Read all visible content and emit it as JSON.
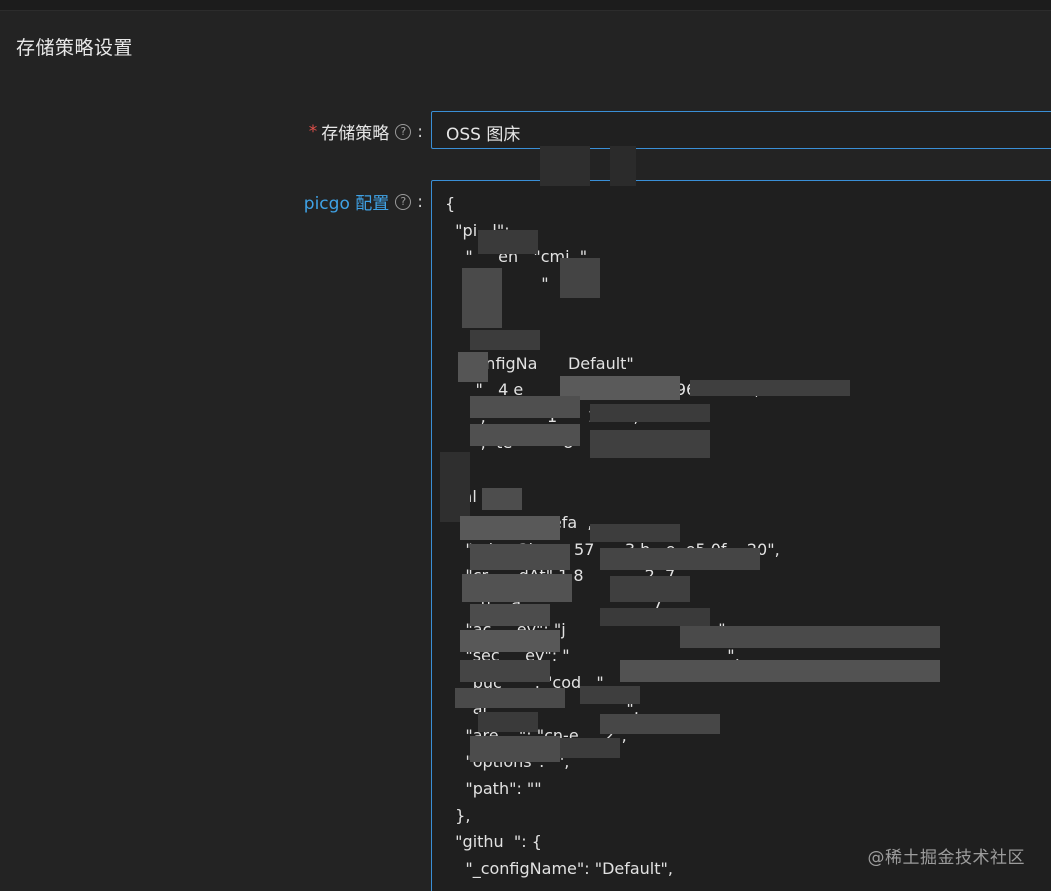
{
  "section": {
    "title": "存储策略设置"
  },
  "form": {
    "strategy_label": "存储策略",
    "required_mark": "*",
    "strategy_help": "?",
    "strategy_colon": ":",
    "strategy_value": "OSS 图床",
    "picgo_label": "picgo 配置",
    "picgo_help": "?",
    "picgo_colon": ":",
    "picgo_config_lines": [
      "{",
      "  \"pi   l\":",
      "    \"     en   \"cmi  \"",
      "         a        \"",
      "",
      "       e    \"\",",
      "      onfigNa      Default\"",
      "      \"   4 e        4        43 7 8696 29   2\",",
      "       ;            1      1     3,",
      "       ;  te          8        0      51",
      "  },",
      "  \"al  \" {",
      "    \"_    am     efa  ,",
      "    \"  d     3ba     57      3 b   e  e5 0f    20\",",
      "    \"cr      dAt\" 1 8            2  7",
      "    \"_u    a                          7",
      "    \"ac     ey\": \"j                              \",",
      "    \"sec     ey\": \"                               \",",
      "    \"buc     \": \"cod   \",",
      "    \"ar                           \",",
      "    \"are    \": \"cn-e     2\",",
      "    \"options\": \"\",",
      "    \"path\": \"\"",
      "  },",
      "  \"githu  \": {",
      "    \"_configName\": \"Default\","
    ]
  },
  "watermark": {
    "text": "@稀土掘金技术社区"
  },
  "colors": {
    "background": "#232323",
    "accent_border": "#3a8fd6",
    "picgo_label": "#3fa2e6",
    "required": "#e0504a"
  },
  "icons": {
    "help": "question-circle-icon"
  }
}
